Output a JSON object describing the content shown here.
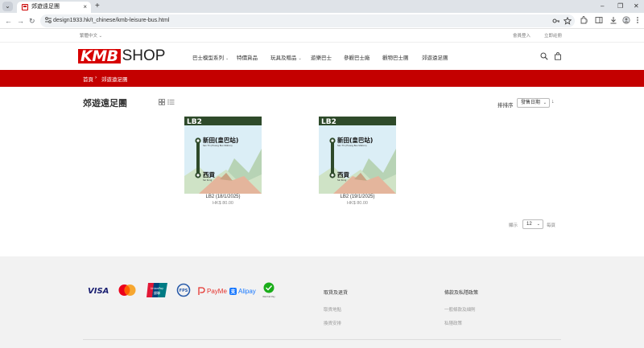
{
  "browser": {
    "tab_title": "郊遊遠足團",
    "url": "design1933.hk/t_chinese/kmb-leisure-bus.html",
    "new_tab_label": "+",
    "tab_close_label": "×",
    "tab_list_label": "⌄",
    "window_controls": {
      "minimize": "–",
      "restore": "❐",
      "close": "✕"
    },
    "nav": {
      "back": "←",
      "forward": "→",
      "reload": "↻"
    }
  },
  "utility": {
    "language": "繁體中文 ⌄",
    "login": "會員登入",
    "register": "立即註冊"
  },
  "header": {
    "logo_kmb": "KMB",
    "logo_shop": "SHOP",
    "nav": [
      {
        "label": "巴士模型系列",
        "has_dropdown": true
      },
      {
        "label": "特價貨品",
        "has_dropdown": false
      },
      {
        "label": "玩具及贈品",
        "has_dropdown": true
      },
      {
        "label": "遊樂巴士",
        "has_dropdown": false
      },
      {
        "label": "參觀巴士廠",
        "has_dropdown": false
      },
      {
        "label": "觀物巴士團",
        "has_dropdown": false
      },
      {
        "label": "郊遊遠足團",
        "has_dropdown": false
      }
    ],
    "dropdown_caret": "⌄"
  },
  "breadcrumb": {
    "home": "首頁",
    "separator": "›",
    "current": "郊遊遠足團"
  },
  "listing": {
    "title": "郊遊遠足團",
    "sort_label": "排排序",
    "sort_value": "發售日期",
    "sort_direction": "↓",
    "per_page_label": "顯示",
    "per_page_value": "12",
    "per_page_unit": "每頁",
    "select_caret": "⌄"
  },
  "products": [
    {
      "name": "LB2 (18/1/2025)",
      "price": "HK$ 80.00",
      "route": "LB2",
      "from_zh": "新田(皇巴站)",
      "from_en": "San Tin (Huang Bus Station)",
      "to_zh": "西貢",
      "to_en": "Sai Kung"
    },
    {
      "name": "LB2 (19/1/2025)",
      "price": "HK$ 80.00",
      "route": "LB2",
      "from_zh": "新田(皇巴站)",
      "from_en": "San Tin (Huang Bus Station)",
      "to_zh": "西貢",
      "to_en": "Sai Kung"
    }
  ],
  "footer": {
    "payments": {
      "visa": "VISA",
      "unionpay": "UnionPay",
      "unionpay_zh": "銀聯",
      "fps": "FPS",
      "payme": "PayMe",
      "alipay": "Alipay",
      "wechat": "WeChat Pay"
    },
    "col1_heading": "取貨及退貨",
    "col1_links": [
      "取貨地點",
      "換貨安排"
    ],
    "col2_heading": "條款及私隱政策",
    "col2_links": [
      "一般條款及細則",
      "私隱政策"
    ]
  },
  "colors": {
    "brand_red": "#c40000",
    "route_green": "#2e4a2a",
    "sky": "#dbeef6"
  }
}
